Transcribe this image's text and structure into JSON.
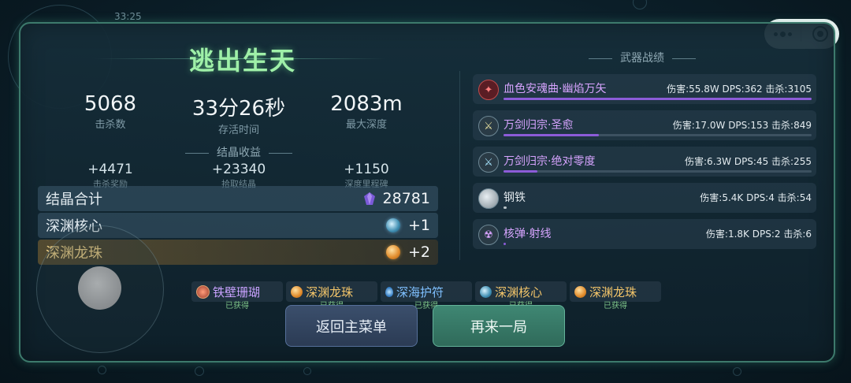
{
  "status": {
    "clock": "33:25"
  },
  "capsule": {
    "more_icon": "ellipsis-icon",
    "close_icon": "target-icon"
  },
  "title": "逃出生天",
  "summary": [
    {
      "value": "5068",
      "label": "击杀数"
    },
    {
      "value": "33分26秒",
      "label": "存活时间"
    },
    {
      "value": "2083m",
      "label": "最大深度"
    }
  ],
  "crystal_section": {
    "title": "结晶收益",
    "items": [
      {
        "value": "+4471",
        "label": "击杀奖励"
      },
      {
        "value": "+23340",
        "label": "拾取结晶"
      },
      {
        "value": "+1150",
        "label": "深度里程碑"
      }
    ]
  },
  "totals": [
    {
      "label": "结晶合计",
      "value": "28781",
      "icon": "crystal-icon"
    },
    {
      "label": "深渊核心",
      "value": "+1",
      "icon": "abyss-core-icon"
    },
    {
      "label": "深渊龙珠",
      "value": "+2",
      "icon": "dragon-pearl-icon"
    }
  ],
  "weapons_section": {
    "title": "武器战绩",
    "items": [
      {
        "name": "血色安魂曲·幽焰万矢",
        "stats": "伤害:55.8W DPS:362 击杀:3105",
        "share": 1.0,
        "icon": "bow-icon",
        "color": "#8c5cd8"
      },
      {
        "name": "万剑归宗·圣愈",
        "stats": "伤害:17.0W DPS:153 击杀:849",
        "share": 0.31,
        "icon": "sword-icon",
        "color": "#8c5cd8"
      },
      {
        "name": "万剑归宗·绝对零度",
        "stats": "伤害:6.3W DPS:45 击杀:255",
        "share": 0.11,
        "icon": "ice-sword-icon",
        "color": "#8c5cd8"
      },
      {
        "name": "钢铁",
        "stats": "伤害:5.4K DPS:4 击杀:54",
        "share": 0.01,
        "icon": "steel-icon",
        "color": "#b9c3c8"
      },
      {
        "name": "核弹·射线",
        "stats": "伤害:1.8K DPS:2 击杀:6",
        "share": 0.005,
        "icon": "nuke-icon",
        "color": "#8c5cd8"
      }
    ]
  },
  "rewards": [
    {
      "name": "铁壁珊瑚",
      "status": "已获得",
      "color": "#c9a2ff",
      "icon": "coral-icon"
    },
    {
      "name": "深渊龙珠",
      "status": "已获得",
      "color": "#f3c56a",
      "icon": "dragon-pearl-icon"
    },
    {
      "name": "深海护符",
      "status": "已获得",
      "color": "#7fc0ff",
      "icon": "amulet-icon"
    },
    {
      "name": "深渊核心",
      "status": "已获得",
      "color": "#f3c56a",
      "icon": "abyss-core-icon"
    },
    {
      "name": "深渊龙珠",
      "status": "已获得",
      "color": "#f3c56a",
      "icon": "dragon-pearl-icon"
    }
  ],
  "buttons": {
    "menu": "返回主菜单",
    "again": "再来一局"
  }
}
